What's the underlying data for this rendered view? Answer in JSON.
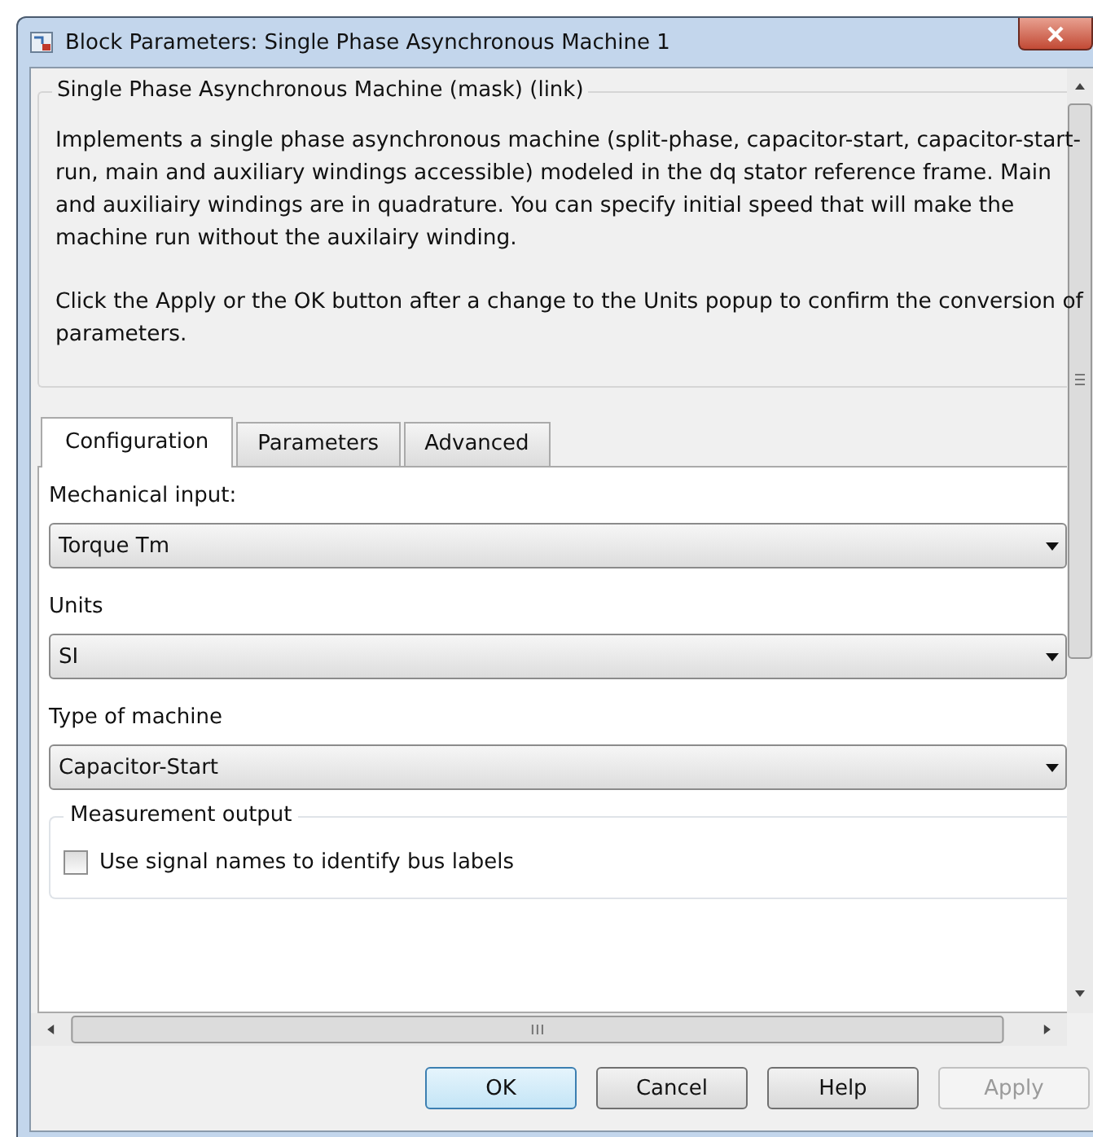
{
  "window": {
    "title": "Block Parameters: Single Phase Asynchronous Machine 1"
  },
  "description": {
    "title": "Single Phase Asynchronous Machine (mask) (link)",
    "paragraphs": [
      "Implements a single phase asynchronous machine (split-phase, capacitor-start, capacitor-start-run,  main and auxiliary windings accessible) modeled in the dq stator reference frame. Main and auxiliairy windings are in quadrature. You can specify initial speed that will make the machine run without the auxilairy winding.",
      "Click the Apply or the OK button after a change to the Units popup to confirm the conversion of parameters."
    ]
  },
  "tabs": [
    {
      "label": "Configuration",
      "selected": true
    },
    {
      "label": "Parameters",
      "selected": false
    },
    {
      "label": "Advanced",
      "selected": false
    }
  ],
  "fields": [
    {
      "label": "Mechanical input:",
      "value": "Torque Tm"
    },
    {
      "label": "Units",
      "value": "SI"
    },
    {
      "label": "Type of machine",
      "value": "Capacitor-Start"
    }
  ],
  "measurement": {
    "title": "Measurement output",
    "options": [
      {
        "label": "Use signal names to identify bus labels",
        "checked": false
      }
    ]
  },
  "buttons": [
    {
      "label": "OK",
      "default": true,
      "disabled": false
    },
    {
      "label": "Cancel",
      "default": false,
      "disabled": false
    },
    {
      "label": "Help",
      "default": false,
      "disabled": false
    },
    {
      "label": "Apply",
      "default": false,
      "disabled": true
    }
  ]
}
